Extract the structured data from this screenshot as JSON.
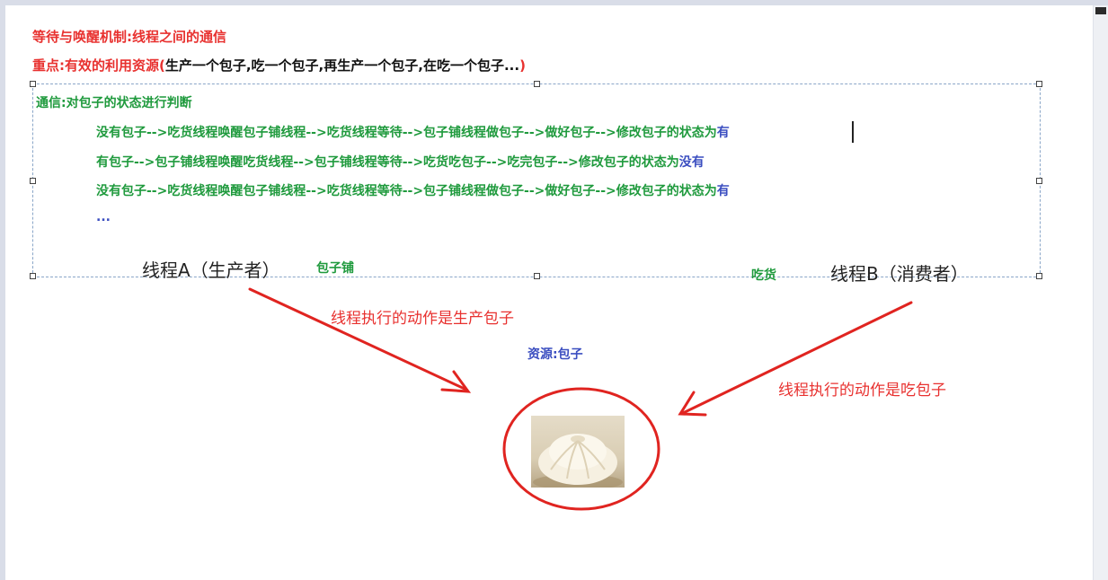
{
  "header": {
    "title": "等待与唤醒机制:线程之间的通信",
    "key_point_prefix": "重点:有效的利用资源",
    "key_point_paren_open": "(",
    "key_point_detail": "生产一个包子,吃一个包子,再生产一个包子,在吃一个包子...",
    "key_point_paren_close": ")"
  },
  "box": {
    "heading": "通信:对包子的状态进行判断",
    "lines": [
      {
        "text": "没有包子-->吃货线程唤醒包子铺线程-->吃货线程等待-->包子铺线程做包子-->做好包子-->修改包子的状态为",
        "state": "有"
      },
      {
        "text": "有包子-->包子铺线程唤醒吃货线程-->包子铺线程等待-->吃货吃包子-->吃完包子-->修改包子的状态为",
        "state": "没有"
      },
      {
        "text": "没有包子-->吃货线程唤醒包子铺线程-->吃货线程等待-->包子铺线程做包子-->做好包子-->修改包子的状态为",
        "state": "有"
      }
    ],
    "ellipsis": "..."
  },
  "threads": {
    "a_label": "线程A（生产者）",
    "a_role": "包子铺",
    "b_role": "吃货",
    "b_label": "线程B（消费者）"
  },
  "annotations": {
    "producer_action": "线程执行的动作是生产包子",
    "resource": "资源:包子",
    "consumer_action": "线程执行的动作是吃包子"
  },
  "colors": {
    "red": "#e8312f",
    "green": "#1f9a3d",
    "blue": "#3b4ec0",
    "black": "#111111"
  },
  "icons": {
    "resource_image": "steamed-bun-photo"
  }
}
